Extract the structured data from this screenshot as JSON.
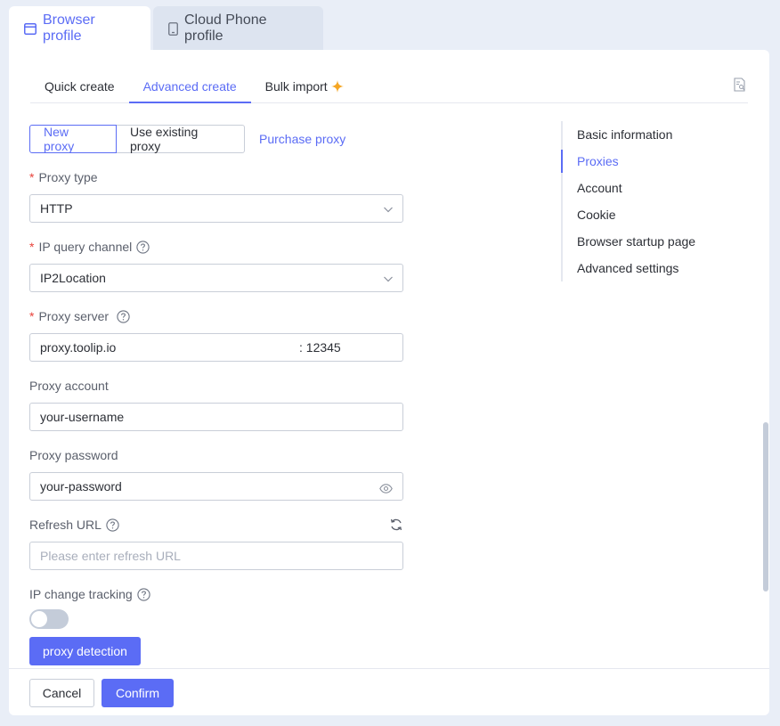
{
  "top_tabs": {
    "browser_profile": "Browser profile",
    "cloud_phone_profile": "Cloud Phone profile"
  },
  "sub_tabs": {
    "quick_create": "Quick create",
    "advanced_create": "Advanced create",
    "bulk_import": "Bulk import"
  },
  "proxy_mode": {
    "new_proxy": "New proxy",
    "use_existing": "Use existing proxy",
    "purchase": "Purchase proxy"
  },
  "form": {
    "proxy_type_label": "Proxy type",
    "proxy_type_value": "HTTP",
    "ip_query_label": "IP query channel",
    "ip_query_value": "IP2Location",
    "proxy_server_label": "Proxy server",
    "proxy_server_host": "proxy.toolip.io",
    "proxy_server_port": ": 12345",
    "proxy_account_label": "Proxy account",
    "proxy_account_value": "your-username",
    "proxy_password_label": "Proxy password",
    "proxy_password_value": "your-password",
    "refresh_url_label": "Refresh URL",
    "refresh_url_placeholder": "Please enter refresh URL",
    "ip_tracking_label": "IP change tracking",
    "ip_tracking_enabled": false,
    "proxy_detection_label": "proxy detection"
  },
  "anchor_nav": {
    "items": [
      "Basic information",
      "Proxies",
      "Account",
      "Cookie",
      "Browser startup page",
      "Advanced settings"
    ],
    "active": "Proxies"
  },
  "footer": {
    "cancel": "Cancel",
    "confirm": "Confirm"
  },
  "colors": {
    "accent": "#5b6cf5",
    "required": "#e8433b",
    "star": "#f5a623"
  }
}
